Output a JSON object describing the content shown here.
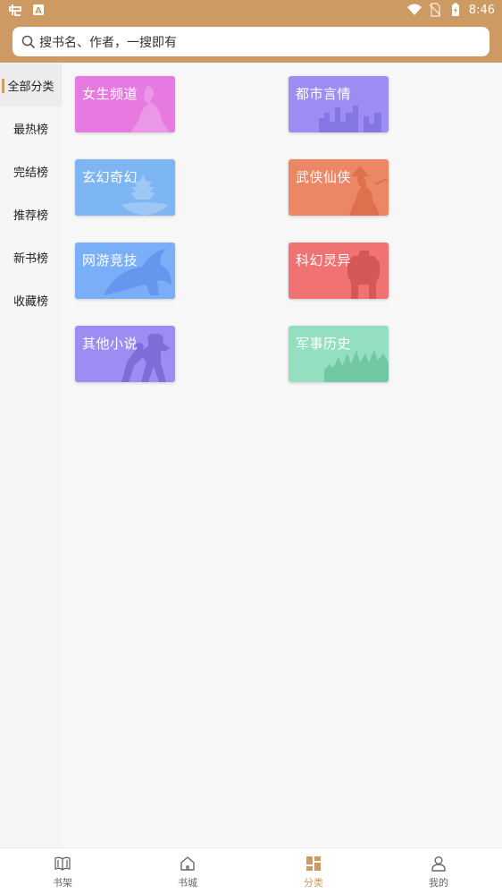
{
  "status_bar": {
    "time": "8:46"
  },
  "search": {
    "placeholder": "搜书名、作者，一搜即有"
  },
  "sidebar": {
    "items": [
      {
        "label": "全部分类",
        "active": true
      },
      {
        "label": "最热榜"
      },
      {
        "label": "完结榜"
      },
      {
        "label": "推荐榜"
      },
      {
        "label": "新书榜"
      },
      {
        "label": "收藏榜"
      }
    ]
  },
  "categories": [
    {
      "label": "女生频道",
      "color": "#e67ae0"
    },
    {
      "label": "都市言情",
      "color": "#9d8cf1"
    },
    {
      "label": "玄幻奇幻",
      "color": "#7eb5f3"
    },
    {
      "label": "武侠仙侠",
      "color": "#ec8766"
    },
    {
      "label": "网游竞技",
      "color": "#7aaef6"
    },
    {
      "label": "科幻灵异",
      "color": "#f07272"
    },
    {
      "label": "其他小说",
      "color": "#9d8cf1"
    },
    {
      "label": "军事历史",
      "color": "#93dfbf"
    }
  ],
  "tabbar": {
    "items": [
      {
        "label": "书架"
      },
      {
        "label": "书城"
      },
      {
        "label": "分类",
        "active": true
      },
      {
        "label": "我的"
      }
    ]
  },
  "colors": {
    "accent": "#cd9a63",
    "background": "#f6f6f6"
  }
}
